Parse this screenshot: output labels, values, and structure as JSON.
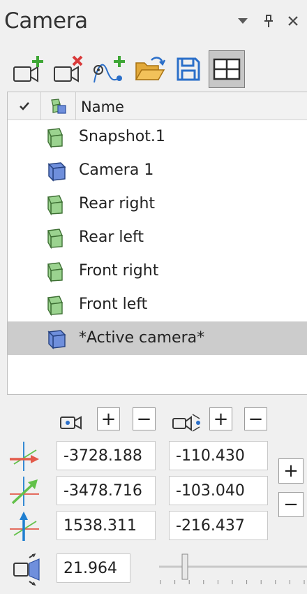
{
  "panel": {
    "title": "Camera"
  },
  "titlebar_icons": [
    "dropdown-arrow-icon",
    "pin-icon",
    "close-icon"
  ],
  "toolbar": {
    "buttons": [
      {
        "name": "add-camera",
        "icon": "camera-add-icon"
      },
      {
        "name": "delete-camera",
        "icon": "camera-delete-icon"
      },
      {
        "name": "add-animation-path",
        "icon": "path-add-icon"
      },
      {
        "name": "open-file",
        "icon": "folder-open-icon"
      },
      {
        "name": "save",
        "icon": "save-icon"
      },
      {
        "name": "layout-toggle",
        "icon": "grid-layout-icon",
        "pressed": true
      }
    ]
  },
  "camera_list": {
    "columns": {
      "check": "checkmark-icon",
      "type": "camera-type-icon",
      "name": "Name"
    },
    "rows": [
      {
        "label": "Snapshot.1",
        "type": "snapshot",
        "selected": false
      },
      {
        "label": "Camera 1",
        "type": "camera",
        "selected": false
      },
      {
        "label": "Rear right",
        "type": "snapshot",
        "selected": false
      },
      {
        "label": "Rear left",
        "type": "snapshot",
        "selected": false
      },
      {
        "label": "Front right",
        "type": "snapshot",
        "selected": false
      },
      {
        "label": "Front left",
        "type": "snapshot",
        "selected": false
      },
      {
        "label": "*Active camera*",
        "type": "camera",
        "selected": true
      }
    ],
    "colors": {
      "snapshot": "#9bd38f",
      "camera": "#6f8fdc",
      "selected_row": "#cccccc"
    }
  },
  "position": {
    "header_icon": "camera-position-icon",
    "plus": "+",
    "minus": "−",
    "x": "-3728.188",
    "y": "-3478.716",
    "z": "1538.311"
  },
  "target": {
    "header_icon": "camera-target-icon",
    "plus": "+",
    "minus": "−",
    "x": "-110.430",
    "y": "-103.040",
    "z": "-216.437"
  },
  "side_step": {
    "plus": "+",
    "minus": "−"
  },
  "axes": [
    {
      "name": "x-axis-icon",
      "color": "#e35a4a"
    },
    {
      "name": "y-axis-icon",
      "color": "#63c14a"
    },
    {
      "name": "z-axis-icon",
      "color": "#1f7fd0"
    }
  ],
  "fov": {
    "icon": "field-of-view-icon",
    "value": "21.964",
    "slider_fraction": 0.17
  }
}
